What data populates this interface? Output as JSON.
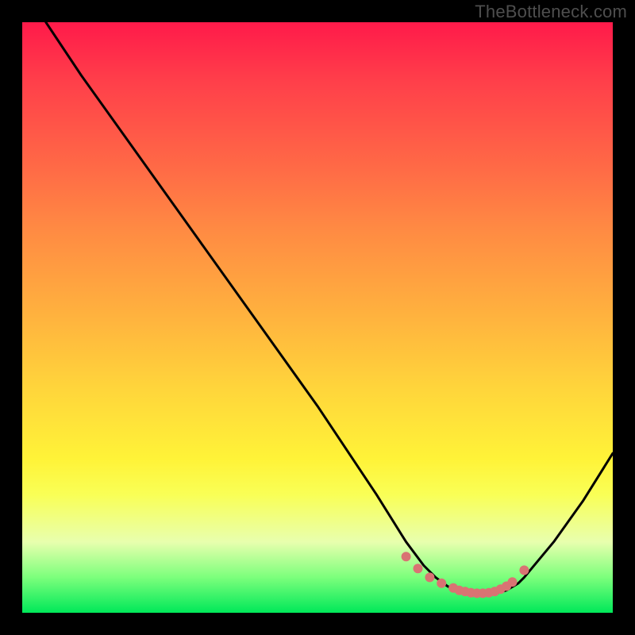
{
  "watermark": "TheBottleneck.com",
  "chart_data": {
    "type": "line",
    "title": "",
    "xlabel": "",
    "ylabel": "",
    "xlim": [
      0,
      100
    ],
    "ylim": [
      0,
      100
    ],
    "series": [
      {
        "name": "curve",
        "x": [
          4,
          10,
          20,
          30,
          40,
          50,
          60,
          65,
          68,
          70,
          72,
          74,
          76,
          78,
          80,
          82,
          84,
          85,
          90,
          95,
          100
        ],
        "y": [
          100,
          91,
          77,
          63,
          49,
          35,
          20,
          12,
          8,
          6,
          4.5,
          3.5,
          3,
          3,
          3.2,
          3.8,
          5,
          6,
          12,
          19,
          27
        ]
      }
    ],
    "flat_region_dots": {
      "x": [
        65,
        67,
        69,
        71,
        73,
        74,
        75,
        76,
        77,
        78,
        79,
        80,
        81,
        82,
        83,
        85
      ],
      "y": [
        9.5,
        7.5,
        6,
        5,
        4.2,
        3.8,
        3.6,
        3.4,
        3.3,
        3.3,
        3.4,
        3.6,
        4,
        4.5,
        5.2,
        7.2
      ]
    },
    "dot_color": "#d97373",
    "curve_color": "#000000"
  }
}
